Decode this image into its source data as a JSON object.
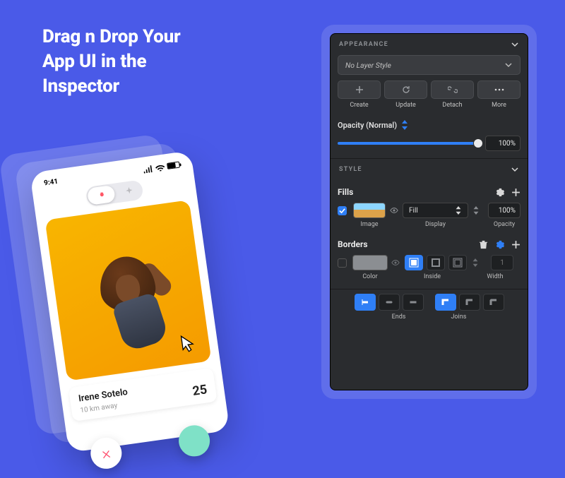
{
  "headline": {
    "line1": "Drag n Drop Your",
    "line2": "App UI in the",
    "line3": "Inspector"
  },
  "phone": {
    "time": "9:41",
    "card": {
      "name": "Irene Sotelo",
      "distance": "10 km away",
      "age": "25"
    }
  },
  "inspector": {
    "appearance": {
      "title": "APPEARANCE",
      "layerStyle": "No Layer Style",
      "buttons": {
        "create": "Create",
        "update": "Update",
        "detach": "Detach",
        "more": "More"
      },
      "opacity": {
        "label": "Opacity (Normal)",
        "value": "100%"
      }
    },
    "style": {
      "title": "STYLE"
    },
    "fills": {
      "title": "Fills",
      "row": {
        "display": "Fill",
        "opacity": "100%"
      },
      "labels": {
        "image": "Image",
        "display": "Display",
        "opacity": "Opacity"
      }
    },
    "borders": {
      "title": "Borders",
      "labels": {
        "color": "Color",
        "position": "Inside",
        "width": "Width"
      },
      "widthValue": "1"
    },
    "endsJoins": {
      "ends": "Ends",
      "joins": "Joins"
    }
  }
}
